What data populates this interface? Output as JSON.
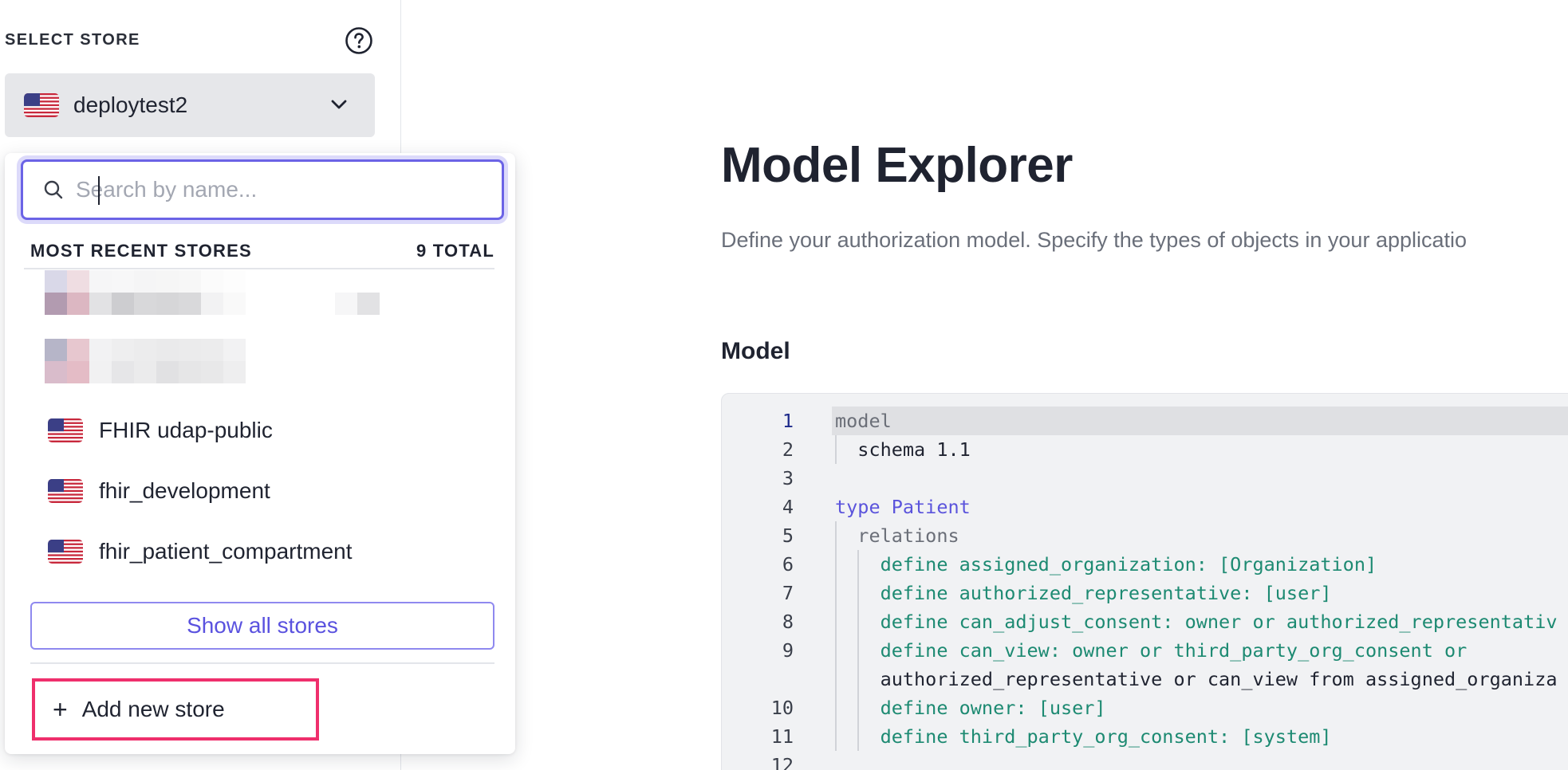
{
  "sidebar": {
    "select_label": "SELECT STORE",
    "current_store": "deploytest2"
  },
  "dropdown": {
    "search_placeholder": "Search by name...",
    "recent_label": "MOST RECENT STORES",
    "total_label": "9 TOTAL",
    "stores": [
      {
        "label": "FHIR udap-public"
      },
      {
        "label": "fhir_development"
      },
      {
        "label": "fhir_patient_compartment"
      }
    ],
    "show_all_label": "Show all stores",
    "add_new_label": "Add new store"
  },
  "main": {
    "title": "Model Explorer",
    "description": "Define your authorization model. Specify the types of objects in your applicatio",
    "section_title": "Model"
  },
  "editor": {
    "lines": [
      {
        "n": "1",
        "text": "model"
      },
      {
        "n": "2",
        "text": "  schema 1.1"
      },
      {
        "n": "3",
        "text": ""
      },
      {
        "n": "4",
        "text": "type Patient"
      },
      {
        "n": "5",
        "text": "  relations"
      },
      {
        "n": "6",
        "text": "    define assigned_organization: [Organization]"
      },
      {
        "n": "7",
        "text": "    define authorized_representative: [user]"
      },
      {
        "n": "8",
        "text": "    define can_adjust_consent: owner or authorized_representativ"
      },
      {
        "n": "9",
        "text": "    define can_view: owner or third_party_org_consent or"
      },
      {
        "n": "",
        "text": "    authorized_representative or can_view from assigned_organiza"
      },
      {
        "n": "10",
        "text": "    define owner: [user]"
      },
      {
        "n": "11",
        "text": "    define third_party_org_consent: [system]"
      },
      {
        "n": "12",
        "text": ""
      }
    ]
  }
}
